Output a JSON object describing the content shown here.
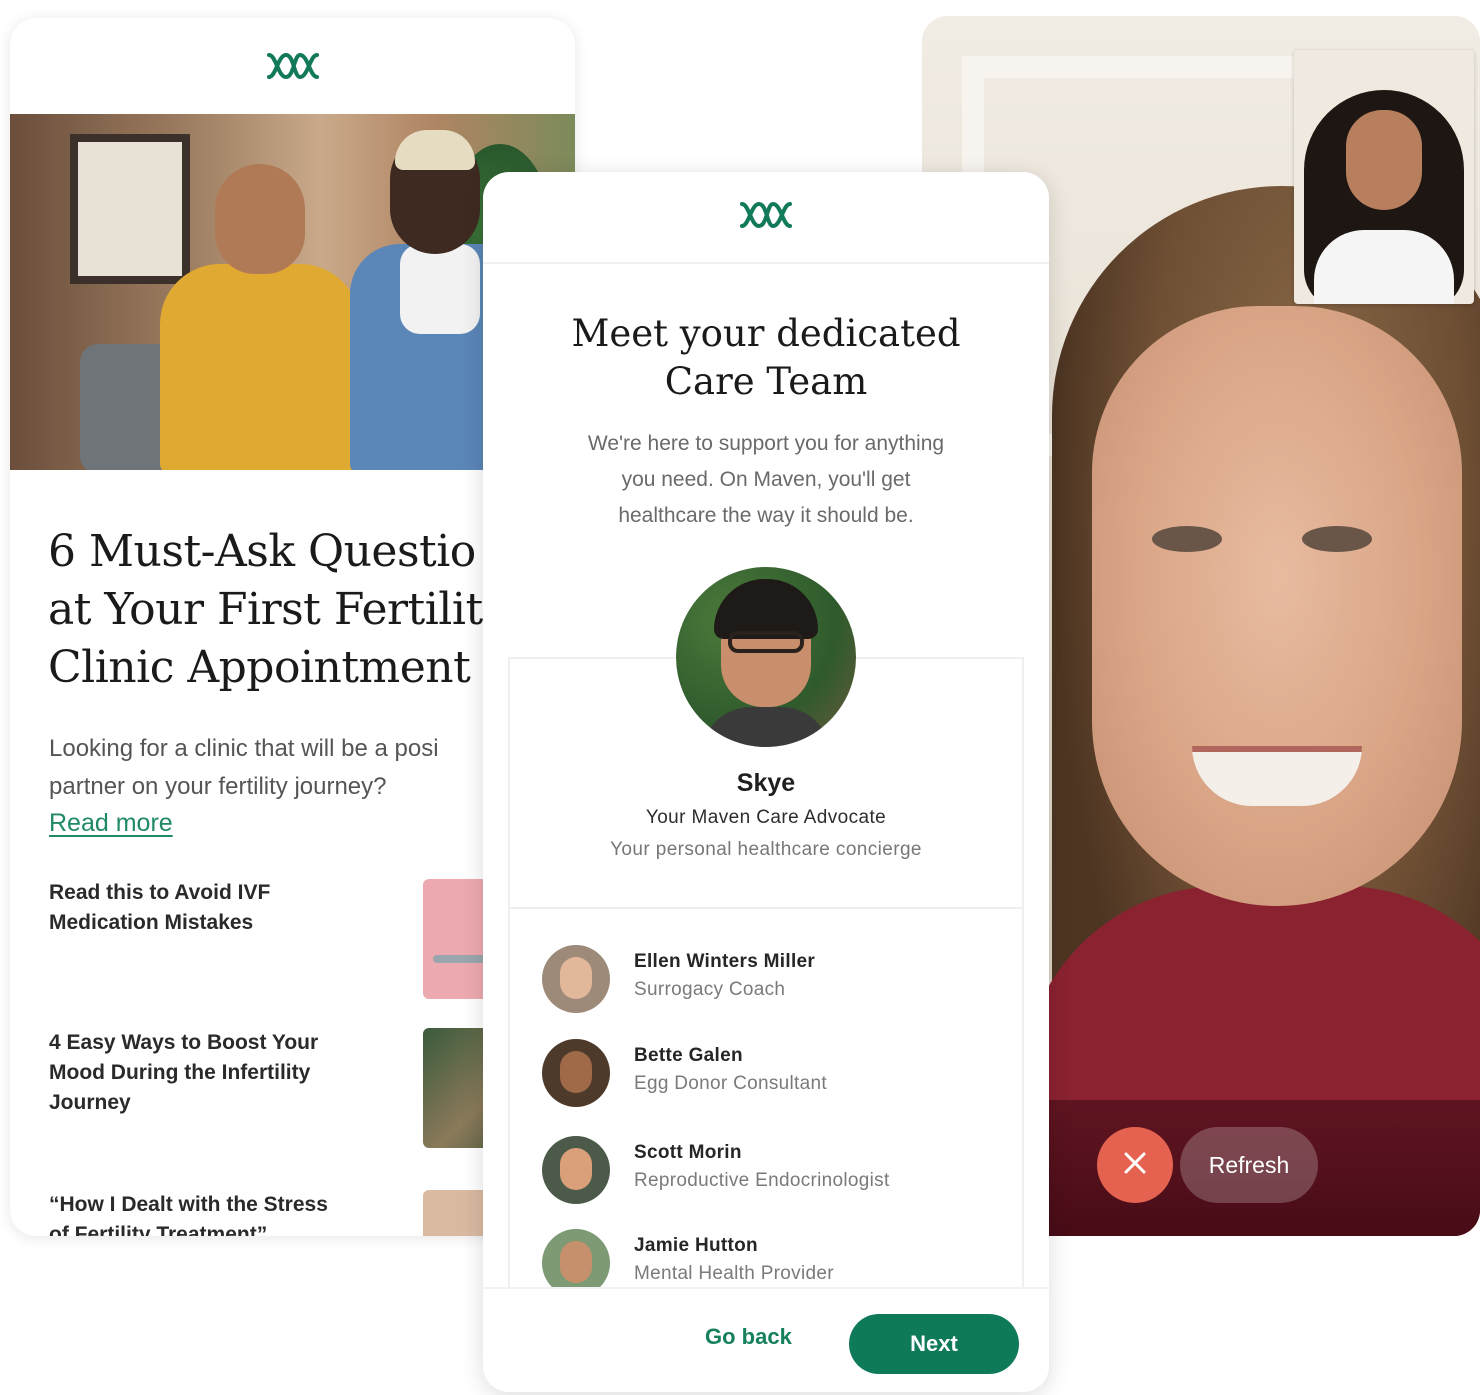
{
  "brand": {
    "logo_icon": "maven-logo-icon",
    "accent_color": "#16805c",
    "button_color": "#0f7a5a"
  },
  "article_card": {
    "title": "6 Must-Ask Questio\nat Your First Fertilit\nClinic Appointment",
    "description": "Looking for a clinic that will be a posi\npartner on your fertility journey?",
    "read_more": "Read more",
    "related": [
      {
        "title": "Read this to Avoid IVF\nMedication Mistakes"
      },
      {
        "title": "4 Easy Ways to Boost Your\nMood During the Infertility\nJourney"
      },
      {
        "title": "“How I Dealt with the Stress\nof Fertility Treatment”"
      }
    ]
  },
  "care_team_card": {
    "title": "Meet your dedicated\nCare Team",
    "subtitle": "We're here to support you for anything\nyou need. On Maven, you'll get\nhealthcare the way it should be.",
    "advocate": {
      "name": "Skye",
      "role": "Your Maven Care Advocate",
      "description": "Your personal healthcare concierge"
    },
    "members": [
      {
        "name": "Ellen Winters Miller",
        "role": "Surrogacy Coach"
      },
      {
        "name": "Bette Galen",
        "role": "Egg Donor Consultant"
      },
      {
        "name": "Scott Morin",
        "role": "Reproductive Endocrinologist"
      },
      {
        "name": "Jamie Hutton",
        "role": "Mental Health Provider"
      }
    ],
    "go_back_label": "Go back",
    "next_label": "Next"
  },
  "video_call_card": {
    "end_call_icon": "close-icon",
    "end_call_color": "#e4624f",
    "refresh_label": "Refresh"
  }
}
